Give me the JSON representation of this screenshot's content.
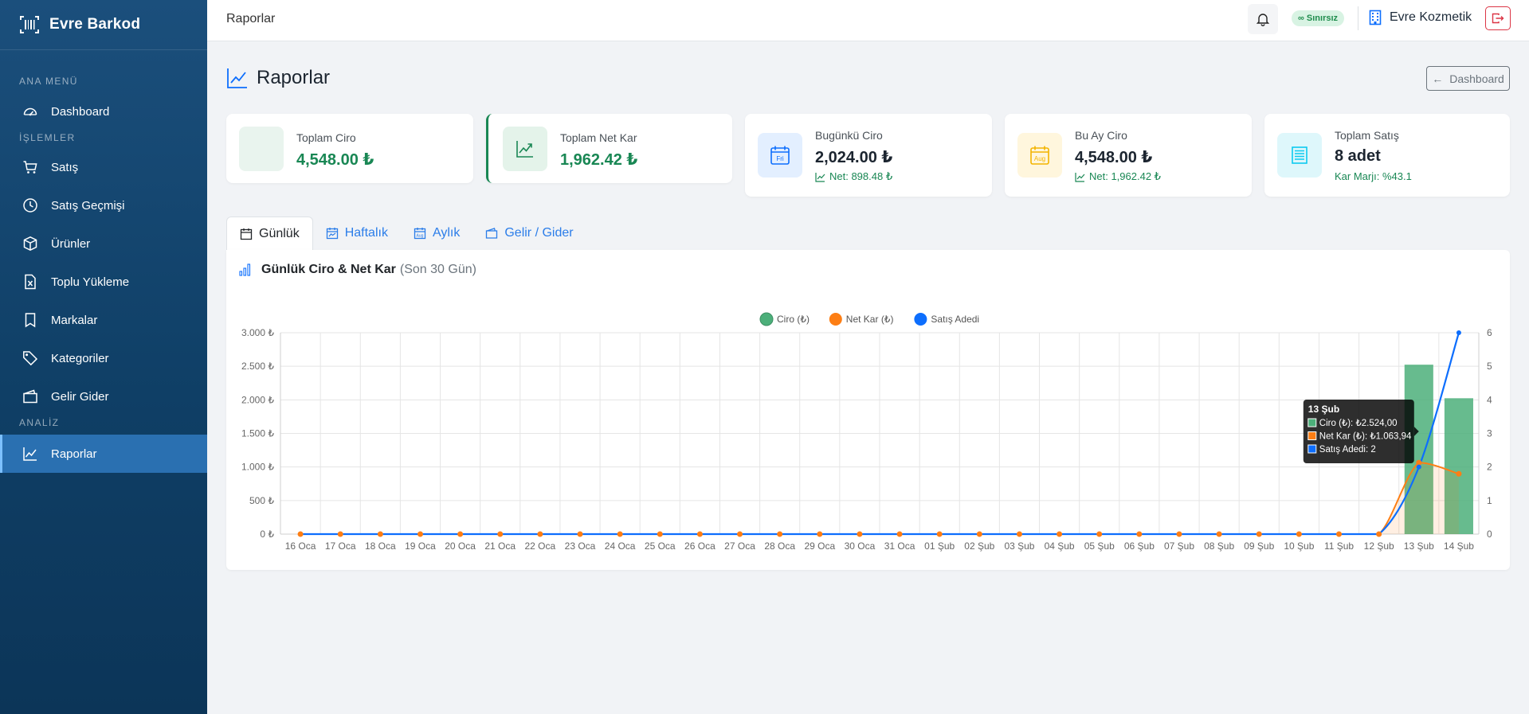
{
  "brand": {
    "name": "Evre Barkod"
  },
  "sidebar": {
    "sections": [
      {
        "label": "ANA MENÜ"
      },
      {
        "label": "İŞLEMLER"
      },
      {
        "label": "ANALİZ"
      }
    ],
    "items": [
      {
        "label": "Dashboard",
        "icon": "speedometer-icon"
      },
      {
        "label": "Satış",
        "icon": "cart-icon"
      },
      {
        "label": "Satış Geçmişi",
        "icon": "clock-icon"
      },
      {
        "label": "Ürünler",
        "icon": "box-icon"
      },
      {
        "label": "Toplu Yükleme",
        "icon": "excel-file-icon"
      },
      {
        "label": "Markalar",
        "icon": "bookmark-icon"
      },
      {
        "label": "Kategoriler",
        "icon": "tags-icon"
      },
      {
        "label": "Gelir Gider",
        "icon": "wallet-icon"
      },
      {
        "label": "Raporlar",
        "icon": "graph-up-icon",
        "active": true
      }
    ]
  },
  "topbar": {
    "breadcrumb": "Raporlar",
    "plan_badge": "∞ Sınırsız",
    "company": "Evre Kozmetik"
  },
  "header": {
    "title": "Raporlar",
    "back_label": "Dashboard"
  },
  "stats": [
    {
      "label": "Toplam Ciro",
      "value": "4,548.00 ₺",
      "icon": "empty-icon"
    },
    {
      "label": "Toplam Net Kar",
      "value": "1,962.42 ₺",
      "icon": "graph-up-icon"
    },
    {
      "label": "Bugünkü Ciro",
      "value": "2,024.00 ₺",
      "sub": "Net: 898.48 ₺",
      "icon": "calendar-fri-icon",
      "icon_text": "Fri"
    },
    {
      "label": "Bu Ay Ciro",
      "value": "4,548.00 ₺",
      "sub": "Net: 1,962.42 ₺",
      "icon": "calendar-aug-icon",
      "icon_text": "Aug"
    },
    {
      "label": "Toplam Satış",
      "value": "8 adet",
      "sub": "Kar Marjı: %43.1",
      "icon": "receipt-icon"
    }
  ],
  "tabs": [
    {
      "label": "Günlük",
      "active": true
    },
    {
      "label": "Haftalık"
    },
    {
      "label": "Aylık"
    },
    {
      "label": "Gelir / Gider"
    }
  ],
  "chart_panel": {
    "title": "Günlük Ciro & Net Kar",
    "note": "(Son 30 Gün)"
  },
  "colors": {
    "ciro": "#4caf7a",
    "net_kar": "#fd7e14",
    "adet": "#0d6efd",
    "value_green": "#198754"
  },
  "chart_data": {
    "type": "bar",
    "categories": [
      "16 Oca",
      "17 Oca",
      "18 Oca",
      "19 Oca",
      "20 Oca",
      "21 Oca",
      "22 Oca",
      "23 Oca",
      "24 Oca",
      "25 Oca",
      "26 Oca",
      "27 Oca",
      "28 Oca",
      "29 Oca",
      "30 Oca",
      "31 Oca",
      "01 Şub",
      "02 Şub",
      "03 Şub",
      "04 Şub",
      "05 Şub",
      "06 Şub",
      "07 Şub",
      "08 Şub",
      "09 Şub",
      "10 Şub",
      "11 Şub",
      "12 Şub",
      "13 Şub",
      "14 Şub"
    ],
    "series": [
      {
        "name": "Ciro (₺)",
        "kind": "bar",
        "axis": "left",
        "values": [
          0,
          0,
          0,
          0,
          0,
          0,
          0,
          0,
          0,
          0,
          0,
          0,
          0,
          0,
          0,
          0,
          0,
          0,
          0,
          0,
          0,
          0,
          0,
          0,
          0,
          0,
          0,
          0,
          2524,
          2024
        ]
      },
      {
        "name": "Net Kar (₺)",
        "kind": "area-line",
        "axis": "left",
        "values": [
          0,
          0,
          0,
          0,
          0,
          0,
          0,
          0,
          0,
          0,
          0,
          0,
          0,
          0,
          0,
          0,
          0,
          0,
          0,
          0,
          0,
          0,
          0,
          0,
          0,
          0,
          0,
          0,
          1063.94,
          898.48
        ]
      },
      {
        "name": "Satış Adedi",
        "kind": "line",
        "axis": "right",
        "values": [
          0,
          0,
          0,
          0,
          0,
          0,
          0,
          0,
          0,
          0,
          0,
          0,
          0,
          0,
          0,
          0,
          0,
          0,
          0,
          0,
          0,
          0,
          0,
          0,
          0,
          0,
          0,
          0,
          2,
          6
        ]
      }
    ],
    "y_left": {
      "min": 0,
      "max": 3000,
      "ticks": [
        "0 ₺",
        "500 ₺",
        "1.000 ₺",
        "1.500 ₺",
        "2.000 ₺",
        "2.500 ₺",
        "3.000 ₺"
      ]
    },
    "y_right": {
      "min": 0,
      "max": 6,
      "ticks": [
        "0",
        "1",
        "2",
        "3",
        "4",
        "5",
        "6"
      ]
    },
    "legend_placement": "top-center",
    "grid": true,
    "tooltip": {
      "title": "13 Şub",
      "index": 28,
      "lines": [
        "Ciro (₺): ₺2.524,00",
        "Net Kar (₺): ₺1.063,94",
        "Satış Adedi: 2"
      ]
    }
  }
}
